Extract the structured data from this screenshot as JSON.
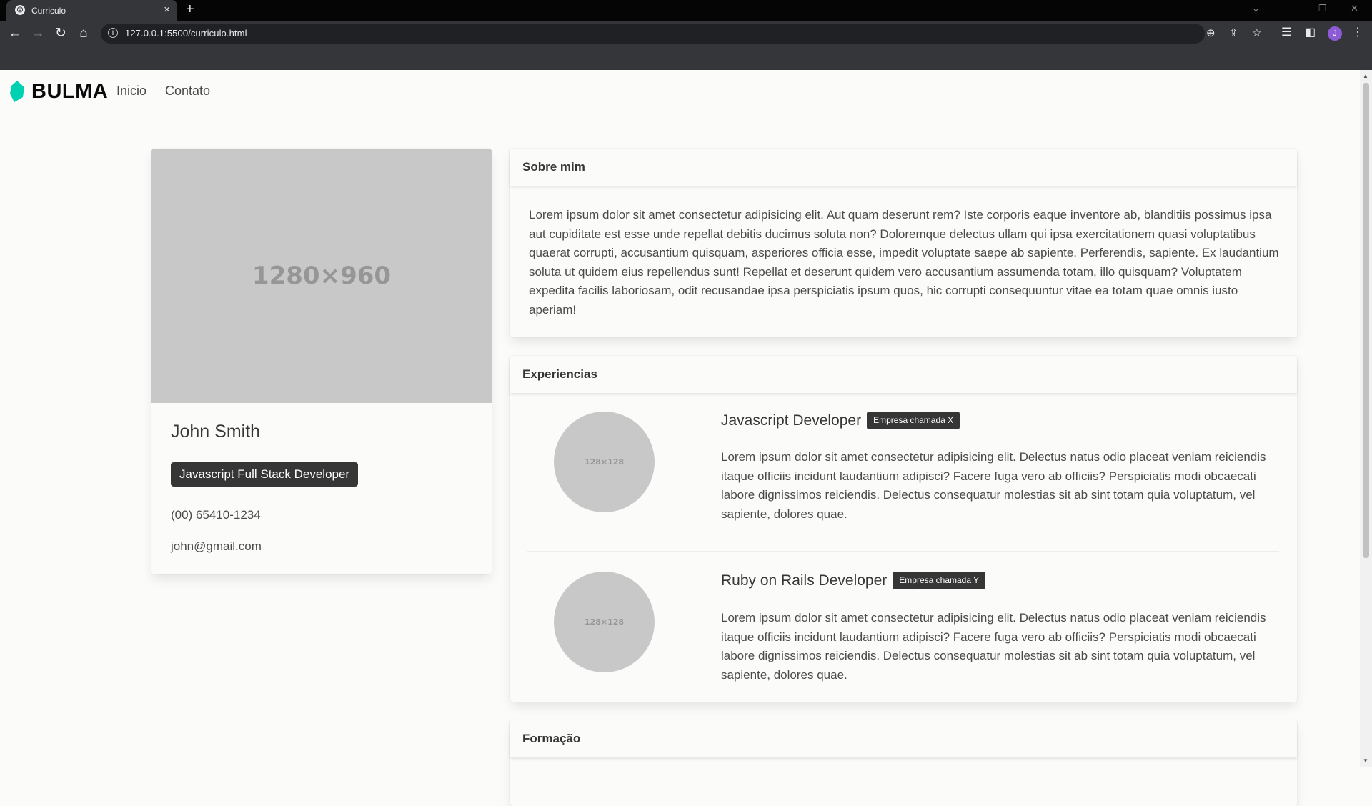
{
  "browser": {
    "tab_title": "Curriculo",
    "tab_close": "×",
    "new_tab": "+",
    "url": "127.0.0.1:5500/curriculo.html",
    "avatar_letter": "J",
    "icons": [
      "back-arrow-icon",
      "forward-arrow-icon",
      "reload-icon",
      "home-icon",
      "info-icon",
      "zoom-icon",
      "share-icon",
      "star-icon",
      "reading-list-icon",
      "side-panel-icon",
      "menu-icon"
    ]
  },
  "navbar": {
    "brand": "BULMA",
    "links": [
      "Inicio",
      "Contato"
    ],
    "accent_color": "#00d1b2"
  },
  "profile": {
    "image_placeholder": "1280×960",
    "name": "John Smith",
    "role": "Javascript Full Stack Developer",
    "phone": "(00) 65410-1234",
    "email": "john@gmail.com"
  },
  "about": {
    "title": "Sobre mim",
    "text": "Lorem ipsum dolor sit amet consectetur adipisicing elit. Aut quam deserunt rem? Iste corporis eaque inventore ab, blanditiis possimus ipsa aut cupiditate est esse unde repellat debitis ducimus soluta non? Doloremque delectus ullam qui ipsa exercitationem quasi voluptatibus quaerat corrupti, accusantium quisquam, asperiores officia esse, impedit voluptate saepe ab sapiente. Perferendis, sapiente. Ex laudantium soluta ut quidem eius repellendus sunt! Repellat et deserunt quidem vero accusantium assumenda totam, illo quisquam? Voluptatem expedita facilis laboriosam, odit recusandae ipsa perspiciatis ipsum quos, hic corrupti consequuntur vitae ea totam quae omnis iusto aperiam!"
  },
  "experiences": {
    "title": "Experiencias",
    "items": [
      {
        "image_placeholder": "128×128",
        "title": "Javascript Developer",
        "company": "Empresa chamada X",
        "description": "Lorem ipsum dolor sit amet consectetur adipisicing elit. Delectus natus odio placeat veniam reiciendis itaque officiis incidunt laudantium adipisci? Facere fuga vero ab officiis? Perspiciatis modi obcaecati labore dignissimos reiciendis. Delectus consequatur molestias sit ab sint totam quia voluptatum, vel sapiente, dolores quae."
      },
      {
        "image_placeholder": "128×128",
        "title": "Ruby on Rails Developer",
        "company": "Empresa chamada Y",
        "description": "Lorem ipsum dolor sit amet consectetur adipisicing elit. Delectus natus odio placeat veniam reiciendis itaque officiis incidunt laudantium adipisci? Facere fuga vero ab officiis? Perspiciatis modi obcaecati labore dignissimos reiciendis. Delectus consequatur molestias sit ab sint totam quia voluptatum, vel sapiente, dolores quae."
      }
    ]
  },
  "education": {
    "title": "Formação"
  }
}
